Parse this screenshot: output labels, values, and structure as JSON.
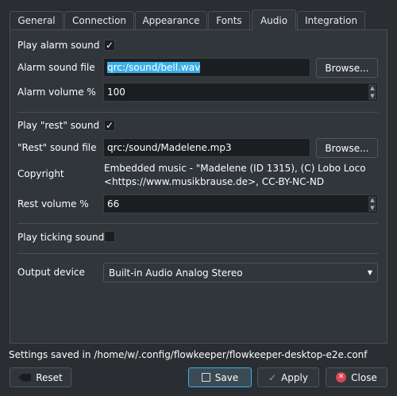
{
  "tabs": [
    "General",
    "Connection",
    "Appearance",
    "Fonts",
    "Audio",
    "Integration"
  ],
  "active_tab": "Audio",
  "audio": {
    "play_alarm_label": "Play alarm sound",
    "play_alarm_checked": true,
    "alarm_file_label": "Alarm sound file",
    "alarm_file_value": "qrc:/sound/bell.wav",
    "browse_label": "Browse...",
    "alarm_volume_label": "Alarm volume %",
    "alarm_volume_value": "100",
    "play_rest_label": "Play \"rest\" sound",
    "play_rest_checked": true,
    "rest_file_label": "\"Rest\" sound file",
    "rest_file_value": "qrc:/sound/Madelene.mp3",
    "copyright_label": "Copyright",
    "copyright_line1": "Embedded music - \"Madelene (ID 1315), (C) Lobo Loco",
    "copyright_line2": "<https://www.musikbrause.de>, CC-BY-NC-ND",
    "rest_volume_label": "Rest volume %",
    "rest_volume_value": "66",
    "play_ticking_label": "Play ticking sound",
    "play_ticking_checked": false,
    "output_device_label": "Output device",
    "output_device_value": "Built-in Audio Analog Stereo"
  },
  "footer": {
    "status": "Settings saved in /home/w/.config/flowkeeper/flowkeeper-desktop-e2e.conf",
    "reset": "Reset",
    "save": "Save",
    "apply": "Apply",
    "close": "Close"
  },
  "check_glyph": "✓"
}
